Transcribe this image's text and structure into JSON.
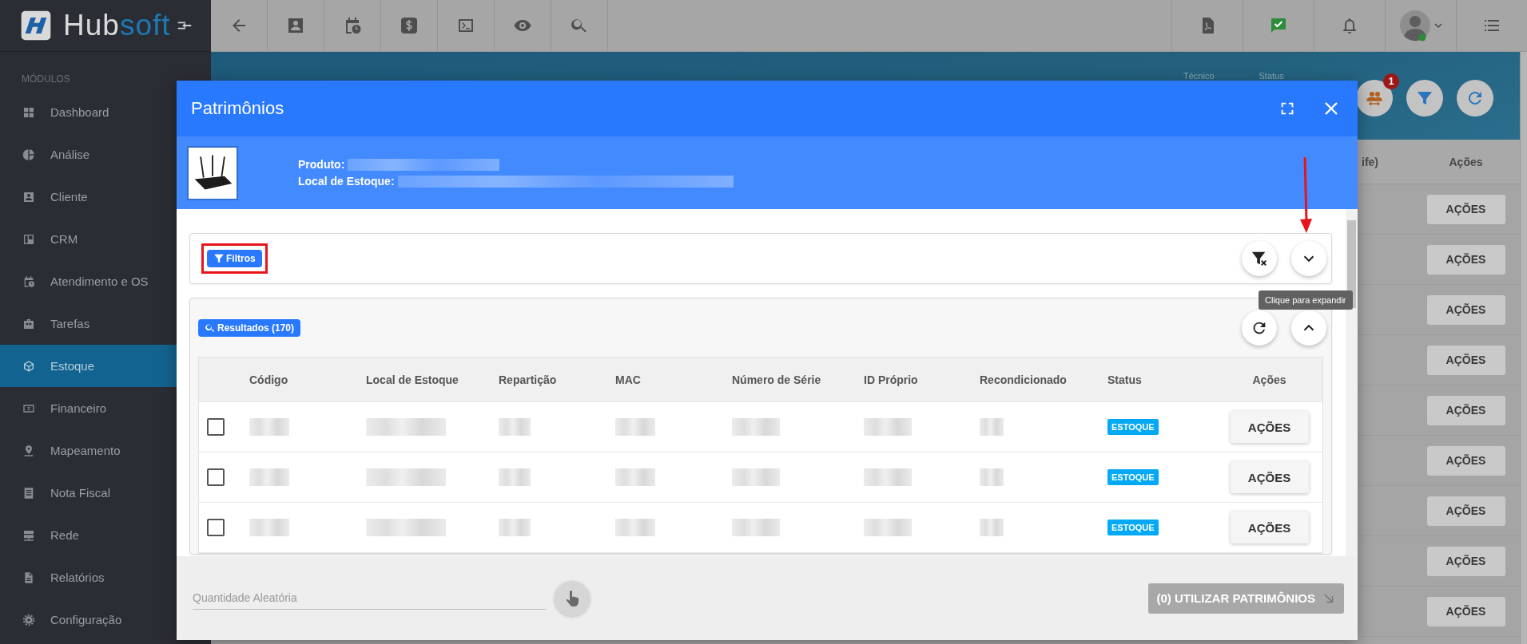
{
  "logo": {
    "part_1": "Hub",
    "part_2": "soft"
  },
  "sidebar": {
    "section": "MÓDULOS",
    "items": [
      {
        "label": "Dashboard",
        "selected": false
      },
      {
        "label": "Análise",
        "selected": false
      },
      {
        "label": "Cliente",
        "selected": false
      },
      {
        "label": "CRM",
        "selected": false
      },
      {
        "label": "Atendimento e OS",
        "selected": false
      },
      {
        "label": "Tarefas",
        "selected": false
      },
      {
        "label": "Estoque",
        "selected": true
      },
      {
        "label": "Financeiro",
        "selected": false
      },
      {
        "label": "Mapeamento",
        "selected": false
      },
      {
        "label": "Nota Fiscal",
        "selected": false
      },
      {
        "label": "Rede",
        "selected": false
      },
      {
        "label": "Relatórios",
        "selected": false
      },
      {
        "label": "Configuração",
        "selected": false
      }
    ]
  },
  "background": {
    "labels": [
      "Técnico",
      "Status"
    ],
    "badge": "1",
    "columns": [
      "ife)",
      "Ações"
    ],
    "row_buttons": [
      "AÇÕES",
      "AÇÕES",
      "AÇÕES",
      "AÇÕES",
      "AÇÕES",
      "AÇÕES",
      "AÇÕES",
      "AÇÕES",
      "AÇÕES"
    ]
  },
  "modal": {
    "title": "Patrimônios",
    "product": {
      "labels": [
        "Produto:",
        "Local de Estoque:"
      ]
    },
    "filters": {
      "button": "Filtros",
      "expanded": false,
      "tooltip": "Clique para expandir"
    },
    "results": {
      "button": "Resultados (170)",
      "expanded": true
    },
    "table": {
      "columns": [
        "Código",
        "Local de Estoque",
        "Repartição",
        "MAC",
        "Número de Série",
        "ID Próprio",
        "Recondicionado",
        "Status",
        "Ações"
      ],
      "rows": [
        {
          "checked": false,
          "status": "ESTOQUE",
          "action": "AÇÕES"
        },
        {
          "checked": false,
          "status": "ESTOQUE",
          "action": "AÇÕES"
        },
        {
          "checked": false,
          "status": "ESTOQUE",
          "action": "AÇÕES"
        }
      ]
    },
    "footer": {
      "placeholder": "Quantidade Aleatória",
      "submit": "(0) UTILIZAR PATRIMÔNIOS",
      "disabled": true
    }
  }
}
